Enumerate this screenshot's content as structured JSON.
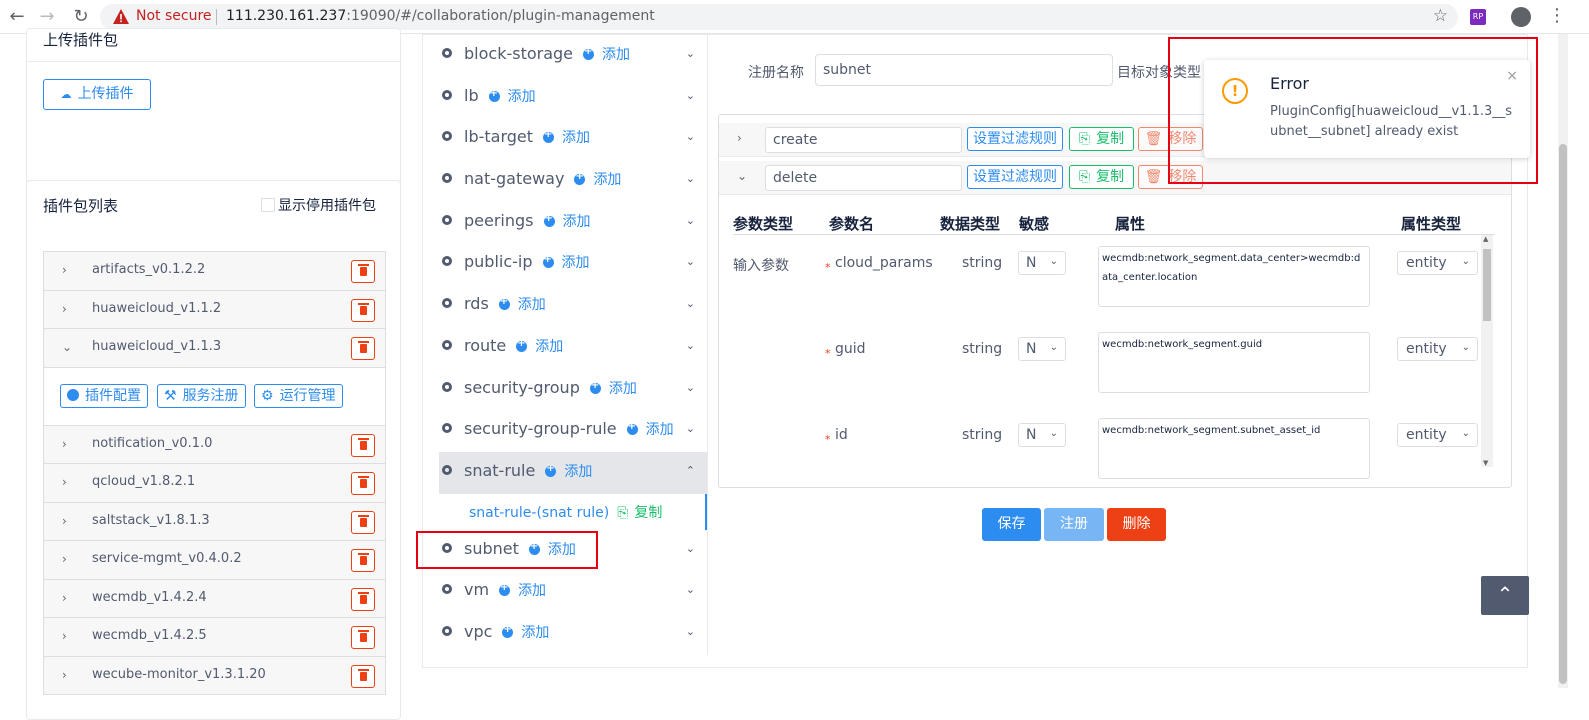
{
  "browser": {
    "back": "←",
    "forward": "→",
    "reload": "↻",
    "security_label": "Not secure",
    "url_host": "111.230.161.237",
    "url_rest": ":19090/#/collaboration/plugin-management",
    "star": "☆",
    "ext": "RP",
    "menu": "⋮"
  },
  "upload_card": {
    "title": "上传插件包",
    "upload_button": "上传插件"
  },
  "package_list": {
    "title": "插件包列表",
    "show_disabled_label": "显示停用插件包",
    "items": [
      {
        "name": "artifacts_v0.1.2.2"
      },
      {
        "name": "huaweicloud_v1.1.2"
      },
      {
        "name": "huaweicloud_v1.1.3"
      },
      {
        "name": "notification_v0.1.0"
      },
      {
        "name": "qcloud_v1.8.2.1"
      },
      {
        "name": "saltstack_v1.8.1.3"
      },
      {
        "name": "service-mgmt_v0.4.0.2"
      },
      {
        "name": "wecmdb_v1.4.2.4"
      },
      {
        "name": "wecmdb_v1.4.2.5"
      },
      {
        "name": "wecube-monitor_v1.3.1.20"
      }
    ],
    "expanded_actions": {
      "plugin_config": "插件配置",
      "service_register": "服务注册",
      "runtime_manage": "运行管理"
    }
  },
  "resources": {
    "add_label": "添加",
    "items": [
      {
        "name": "block-storage"
      },
      {
        "name": "lb"
      },
      {
        "name": "lb-target"
      },
      {
        "name": "nat-gateway"
      },
      {
        "name": "peerings"
      },
      {
        "name": "public-ip"
      },
      {
        "name": "rds"
      },
      {
        "name": "route"
      },
      {
        "name": "security-group"
      },
      {
        "name": "security-group-rule"
      },
      {
        "name": "snat-rule"
      },
      {
        "name": "subnet"
      },
      {
        "name": "vm"
      },
      {
        "name": "vpc"
      }
    ],
    "sub_item": {
      "name": "snat-rule-(snat rule)",
      "copy": "复制"
    }
  },
  "form": {
    "register_name_label": "注册名称",
    "register_name_value": "subnet",
    "target_type_label": "目标对象类型",
    "interfaces": [
      {
        "name": "create",
        "chev": "›"
      },
      {
        "name": "delete",
        "chev": "⌄"
      }
    ],
    "filter_button": "设置过滤规则",
    "copy_button": "复制",
    "remove_button": "移除",
    "table_headers": {
      "param_type": "参数类型",
      "param_name": "参数名",
      "data_type": "数据类型",
      "sensitive": "敏感",
      "attribute": "属性",
      "attribute_type": "属性类型"
    },
    "params": [
      {
        "type": "输入参数",
        "name": "cloud_params",
        "dtype": "string",
        "sensitive": "N",
        "attr": "wecmdb:network_segment.data_center>wecmdb:data_center.location",
        "attr_type": "entity"
      },
      {
        "type": "",
        "name": "guid",
        "dtype": "string",
        "sensitive": "N",
        "attr": "wecmdb:network_segment.guid",
        "attr_type": "entity"
      },
      {
        "type": "",
        "name": "id",
        "dtype": "string",
        "sensitive": "N",
        "attr": "wecmdb:network_segment.subnet_asset_id",
        "attr_type": "entity"
      }
    ],
    "save_button": "保存",
    "register_button": "注册",
    "delete_button": "删除"
  },
  "notification": {
    "icon": "!",
    "title": "Error",
    "message": "PluginConfig[huaweicloud__v1.1.3__subnet__subnet] already exist",
    "close": "×"
  },
  "back_to_top": "⌃",
  "colors": {
    "primary": "#2d8cf0",
    "success": "#19be6b",
    "error": "#ed4014",
    "warning": "#ff9900",
    "highlight_box": "#e60012"
  }
}
